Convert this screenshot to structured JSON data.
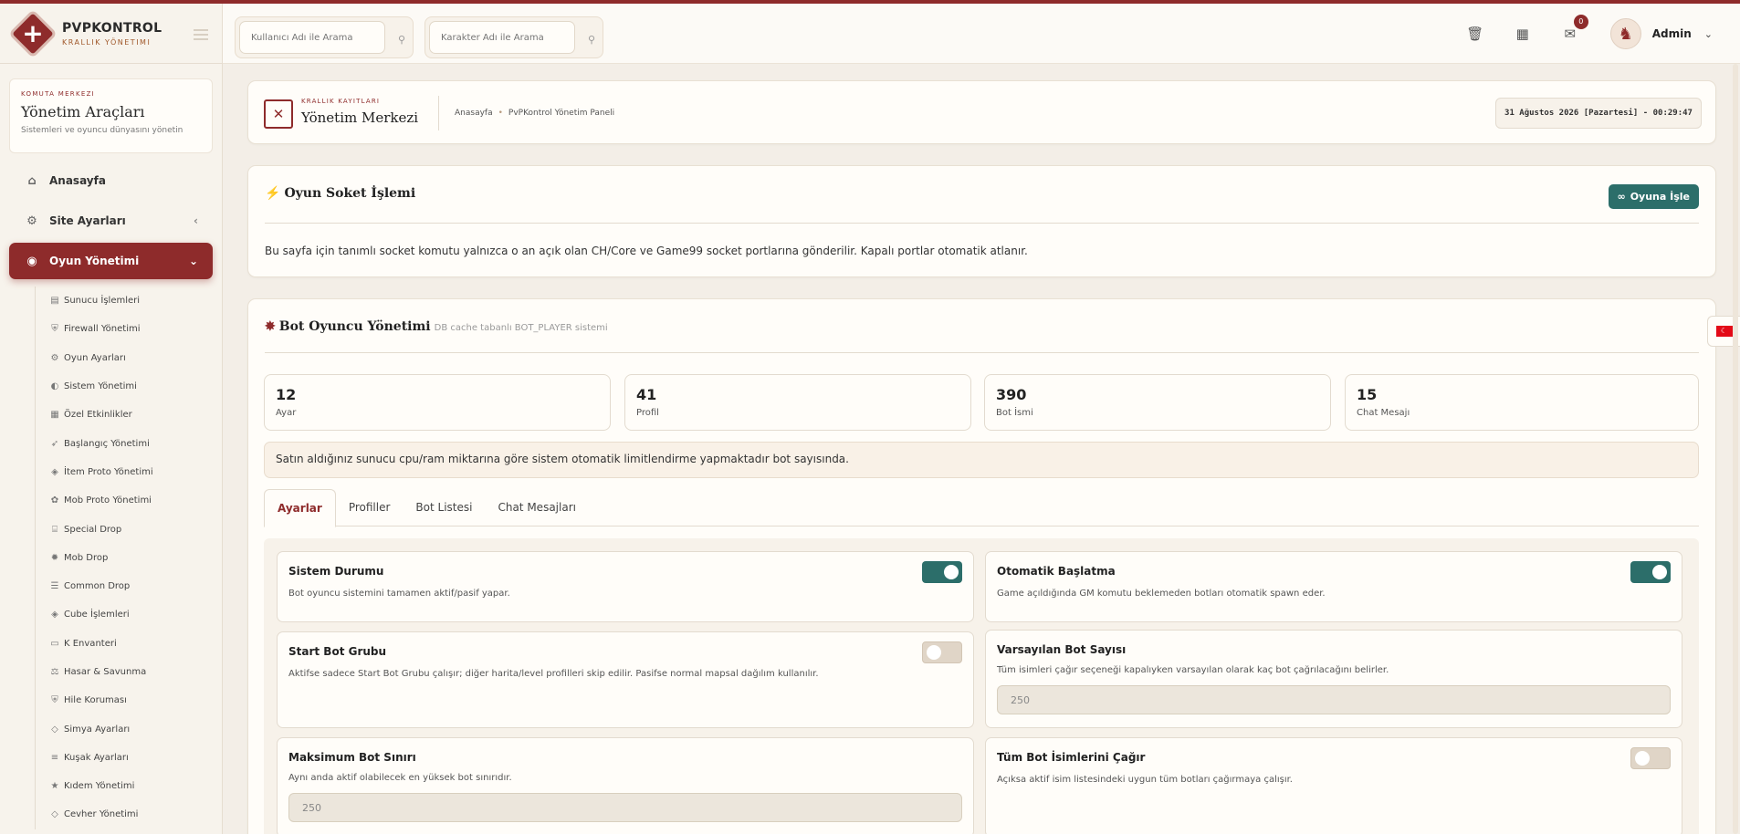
{
  "brand": {
    "title": "PVPKONTROL",
    "subtitle": "KRALLIK YÖNETIMI"
  },
  "sidebar": {
    "command": {
      "kicker": "KOMUTA MERKEZI",
      "title": "Yönetim Araçları",
      "subtitle": "Sistemleri ve oyuncu dünyasını yönetin"
    },
    "items": [
      {
        "label": "Anasayfa",
        "icon": "home-icon"
      },
      {
        "label": "Site Ayarları",
        "icon": "gear-icon"
      },
      {
        "label": "Oyun Yönetimi",
        "icon": "gamepad-icon",
        "active": true
      }
    ],
    "subitems": [
      {
        "label": "Sunucu İşlemleri",
        "icon": "server-icon"
      },
      {
        "label": "Firewall Yönetimi",
        "icon": "shield-icon"
      },
      {
        "label": "Oyun Ayarları",
        "icon": "cogs-icon"
      },
      {
        "label": "Sistem Yönetimi",
        "icon": "toggle-icon"
      },
      {
        "label": "Özel Etkinlikler",
        "icon": "calendar-icon"
      },
      {
        "label": "Başlangıç Yönetimi",
        "icon": "rocket-icon"
      },
      {
        "label": "İtem Proto Yönetimi",
        "icon": "cube-icon"
      },
      {
        "label": "Mob Proto Yönetimi",
        "icon": "paw-icon"
      },
      {
        "label": "Special Drop",
        "icon": "gift-icon"
      },
      {
        "label": "Mob Drop",
        "icon": "bug-icon"
      },
      {
        "label": "Common Drop",
        "icon": "list-icon"
      },
      {
        "label": "Cube İşlemleri",
        "icon": "cube-icon"
      },
      {
        "label": "K Envanteri",
        "icon": "box-icon"
      },
      {
        "label": "Hasar & Savunma",
        "icon": "scale-icon"
      },
      {
        "label": "Hile Koruması",
        "icon": "shield-icon"
      },
      {
        "label": "Simya Ayarları",
        "icon": "gem-icon"
      },
      {
        "label": "Kuşak Ayarları",
        "icon": "sliders-icon"
      },
      {
        "label": "Kıdem Yönetimi",
        "icon": "star-icon"
      },
      {
        "label": "Cevher Yönetimi",
        "icon": "gem-icon"
      }
    ]
  },
  "header": {
    "search_user_placeholder": "Kullanıcı Adı ile Arama",
    "search_char_placeholder": "Karakter Adı ile Arama",
    "mail_badge": "0",
    "user": "Admin"
  },
  "page": {
    "kicker": "KRALLIK KAYITLARI",
    "title": "Yönetim Merkezi",
    "breadcrumb": [
      "Anasayfa",
      "PvPKontrol Yönetim Paneli"
    ],
    "datetime": "31 Ağustos 2026 [Pazartesi] - 00:29:47"
  },
  "socket": {
    "title": "Oyun Soket İşlemi",
    "button": "Oyuna İşle",
    "description": "Bu sayfa için tanımlı socket komutu yalnızca o an açık olan CH/Core ve Game99 socket portlarına gönderilir. Kapalı portlar otomatik atlanır."
  },
  "bot": {
    "title": "Bot Oyuncu Yönetimi",
    "subtitle": "DB cache tabanlı BOT_PLAYER sistemi",
    "stats": [
      {
        "value": "12",
        "label": "Ayar"
      },
      {
        "value": "41",
        "label": "Profil"
      },
      {
        "value": "390",
        "label": "Bot İsmi"
      },
      {
        "value": "15",
        "label": "Chat Mesajı"
      }
    ],
    "notice": "Satın aldığınız sunucu cpu/ram miktarına göre sistem otomatik limitlendirme yapmaktadır bot sayısında.",
    "tabs": [
      "Ayarlar",
      "Profiller",
      "Bot Listesi",
      "Chat Mesajları"
    ],
    "settings": {
      "sistem_durumu": {
        "title": "Sistem Durumu",
        "desc": "Bot oyuncu sistemini tamamen aktif/pasif yapar.",
        "on": true
      },
      "otomatik": {
        "title": "Otomatik Başlatma",
        "desc": "Game açıldığında GM komutu beklemeden botları otomatik spawn eder.",
        "on": true
      },
      "start_grubu": {
        "title": "Start Bot Grubu",
        "desc": "Aktifse sadece Start Bot Grubu çalışır; diğer harita/level profilleri skip edilir. Pasifse normal mapsal dağılım kullanılır.",
        "on": false
      },
      "varsayilan": {
        "title": "Varsayılan Bot Sayısı",
        "desc": "Tüm isimleri çağır seçeneği kapalıyken varsayılan olarak kaç bot çağrılacağını belirler.",
        "value": "250"
      },
      "maksimum": {
        "title": "Maksimum Bot Sınırı",
        "desc": "Aynı anda aktif olabilecek en yüksek bot sınırıdır.",
        "value": "250"
      },
      "tum_isimler": {
        "title": "Tüm Bot İsimlerini Çağır",
        "desc": "Açıksa aktif isim listesindeki uygun tüm botları çağırmaya çalışır.",
        "on": false
      }
    }
  }
}
